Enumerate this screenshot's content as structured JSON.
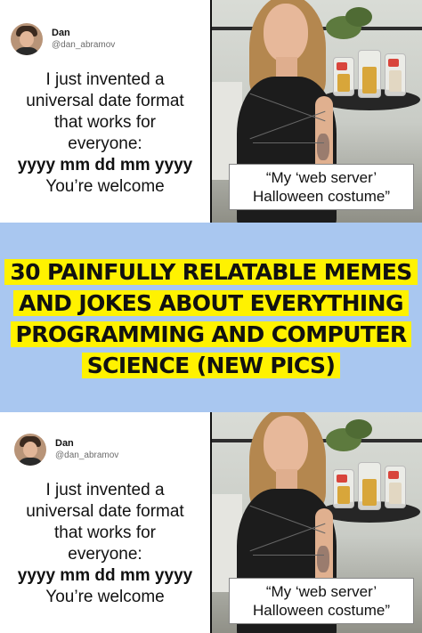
{
  "tweet": {
    "name": "Dan",
    "handle": "@dan_abramov",
    "lines": [
      "I just invented a",
      "universal date format",
      "that works for",
      "everyone:"
    ],
    "format": "yyyy mm dd mm yyyy",
    "closing": "You’re welcome"
  },
  "photo": {
    "caption_line1": "“My ‘web server’",
    "caption_line2": "Halloween costume”"
  },
  "banner": {
    "headline_line1": "30 Painfully Relatable Memes",
    "headline_line2": "And Jokes About Everything",
    "headline_line3": "Programming And Computer",
    "headline_line4": "Science (New Pics)",
    "background": "#a9c7f0",
    "highlight": "#fff200"
  }
}
